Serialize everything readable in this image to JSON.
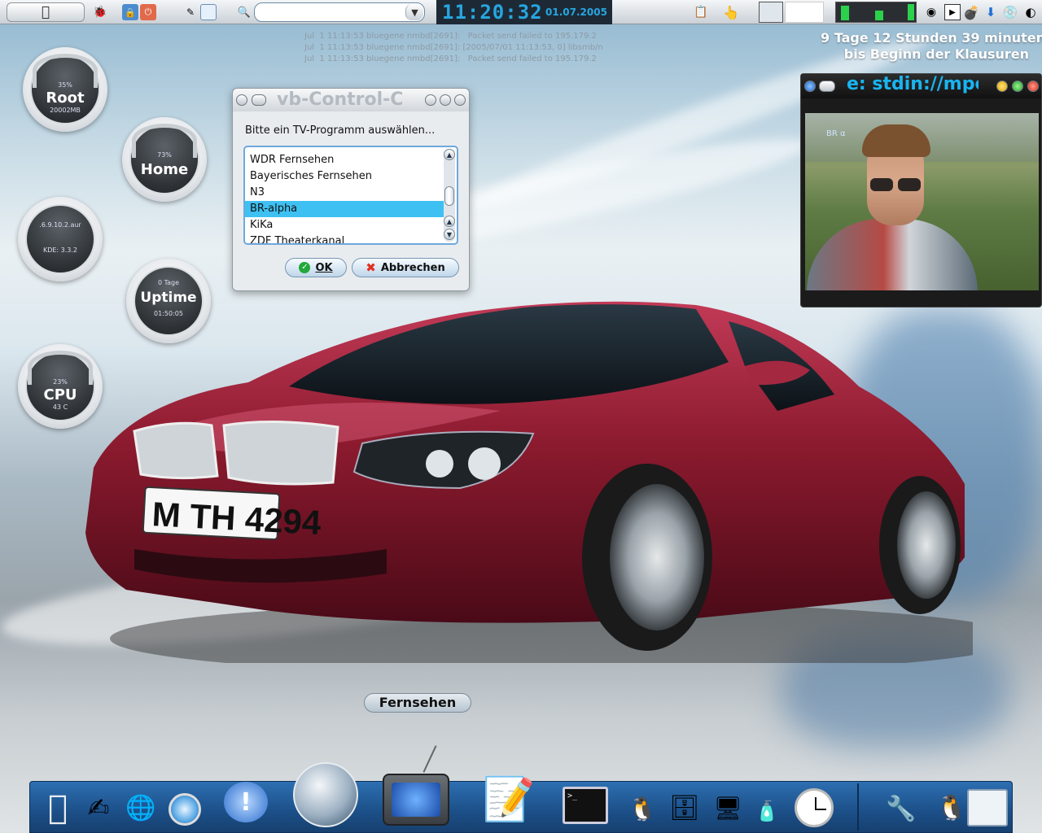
{
  "top_panel": {
    "clock": "11:20:32",
    "date": "01.07.2005",
    "search_value": ""
  },
  "syslog": [
    "Jul  1 11:13:53 bluegene nmbd[2691]:   Packet send failed to 195.179.2",
    "Jul  1 11:13:53 bluegene nmbd[2691]: [2005/07/01 11:13:53, 0] libsmb/n",
    "Jul  1 11:13:53 bluegene nmbd[2691]:   Packet send failed to 195.179.2"
  ],
  "countdown": {
    "line1": "9 Tage 12 Stunden 39 minuten",
    "line2": "bis Beginn der Klausuren"
  },
  "gauges": {
    "root": {
      "percent": "35%",
      "label": "Root",
      "detail": "20002MB",
      "fill": 0.35
    },
    "home": {
      "percent": "73%",
      "label": "Home",
      "fill": 0.73
    },
    "kde": {
      "line1": ".6.9.10.2.aur",
      "line2": "KDE: 3.3.2"
    },
    "uptime": {
      "top": "0 Tage",
      "label": "Uptime",
      "time": "01:50:05"
    },
    "cpu": {
      "percent": "23%",
      "label": "CPU",
      "temp": "43 C",
      "fill": 0.23
    }
  },
  "dialog": {
    "title": "vb-Control-C",
    "prompt": "Bitte ein TV-Programm auswählen...",
    "channels": [
      "WDR Fernsehen",
      "Bayerisches Fernsehen",
      "N3",
      "BR-alpha",
      "KiKa",
      "ZDF Theaterkanal"
    ],
    "selected_index": 3,
    "ok_label": "OK",
    "cancel_label": "Abbrechen"
  },
  "video": {
    "title": "e: stdin://mpe",
    "logo": "BR α"
  },
  "car": {
    "plate": "M TH 4294"
  },
  "dock_label": "Fernsehen",
  "colors": {
    "accent": "#27a6e0",
    "selection": "#3ec0f2",
    "car": "#8b1a2e",
    "dock": "#1c4f88"
  }
}
